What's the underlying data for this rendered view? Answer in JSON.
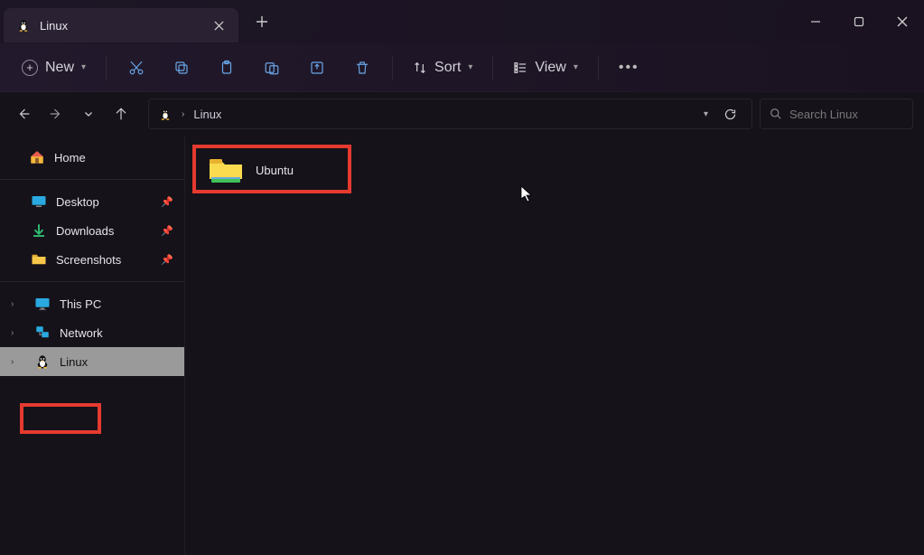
{
  "tab": {
    "title": "Linux"
  },
  "toolbar": {
    "new_label": "New",
    "sort_label": "Sort",
    "view_label": "View"
  },
  "breadcrumb": {
    "root_aria": "Linux",
    "current": "Linux"
  },
  "search": {
    "placeholder": "Search Linux"
  },
  "sidebar": {
    "home": "Home",
    "quick": [
      {
        "label": "Desktop"
      },
      {
        "label": "Downloads"
      },
      {
        "label": "Screenshots"
      }
    ],
    "drives": [
      {
        "label": "This PC"
      },
      {
        "label": "Network"
      },
      {
        "label": "Linux",
        "selected": true
      }
    ]
  },
  "content": {
    "items": [
      {
        "label": "Ubuntu"
      }
    ]
  }
}
